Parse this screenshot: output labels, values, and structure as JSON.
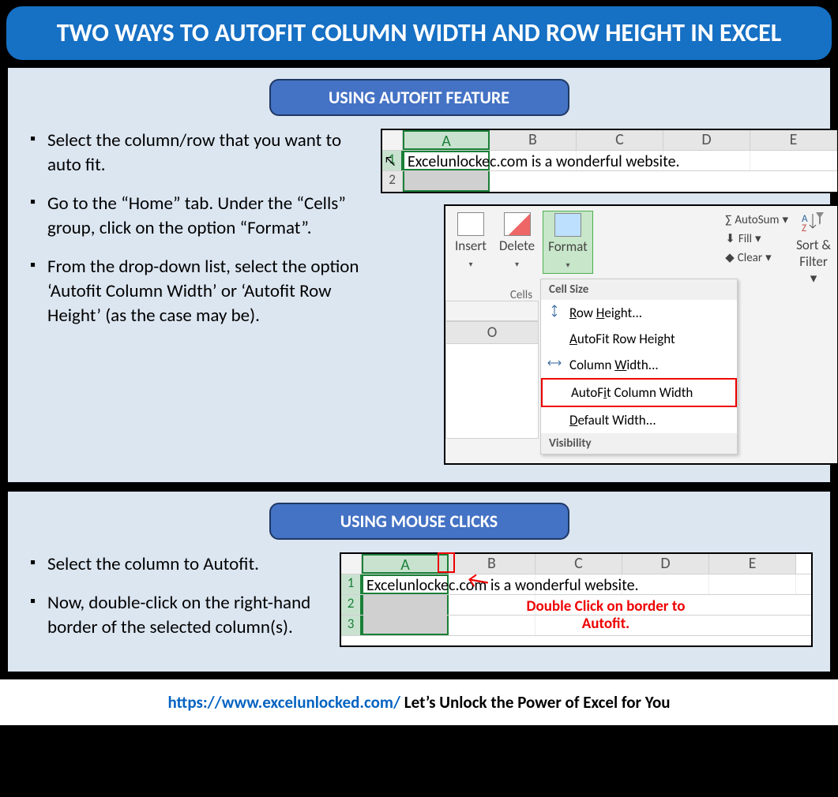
{
  "title": "TWO WAYS TO AUTOFIT COLUMN WIDTH AND ROW HEIGHT IN EXCEL",
  "section1": {
    "heading": "USING AUTOFIT FEATURE",
    "bullets": [
      "Select the column/row that you want to auto fit.",
      "Go to the “Home” tab. Under the “Cells” group, click on the option “Format”.",
      "From the drop-down list, select the option ‘Autofit Column Width’ or ‘Autofit Row Height’ (as the case may be)."
    ],
    "shot1": {
      "columns": [
        "A",
        "B",
        "C",
        "D",
        "E"
      ],
      "rows": [
        "1",
        "2"
      ],
      "cellA1": "Excelunlockec",
      "spillRest": ".com is a wonderful website."
    },
    "shot2": {
      "ribbon": {
        "insert": "Insert",
        "delete": "Delete",
        "format": "Format",
        "cellsGroup": "Cells",
        "autosum": "AutoSum",
        "fill": "Fill",
        "clear": "Clear",
        "sortFilter": "Sort & Filter"
      },
      "visibleCol": "O",
      "dropdown": {
        "groupLabel": "Cell Size",
        "items": [
          "Row Height...",
          "AutoFit Row Height",
          "Column Width...",
          "AutoFit Column Width",
          "Default Width..."
        ],
        "visibilityLabel": "Visibility"
      }
    }
  },
  "section2": {
    "heading": "USING MOUSE CLICKS",
    "bullets": [
      "Select the column to Autofit.",
      "Now, double-click on the right-hand border of the selected column(s)."
    ],
    "shot3": {
      "columns": [
        "A",
        "B",
        "C",
        "D",
        "E"
      ],
      "rows": [
        "1",
        "2",
        "3"
      ],
      "cellA1": "Excelunlockec",
      "spillRest": ".com is a wonderful website.",
      "annotation": "Double Click on border to Autofit."
    }
  },
  "footer": {
    "url": "https://www.excelunlocked.com/",
    "tagline": " Let’s Unlock the Power of Excel for You"
  }
}
